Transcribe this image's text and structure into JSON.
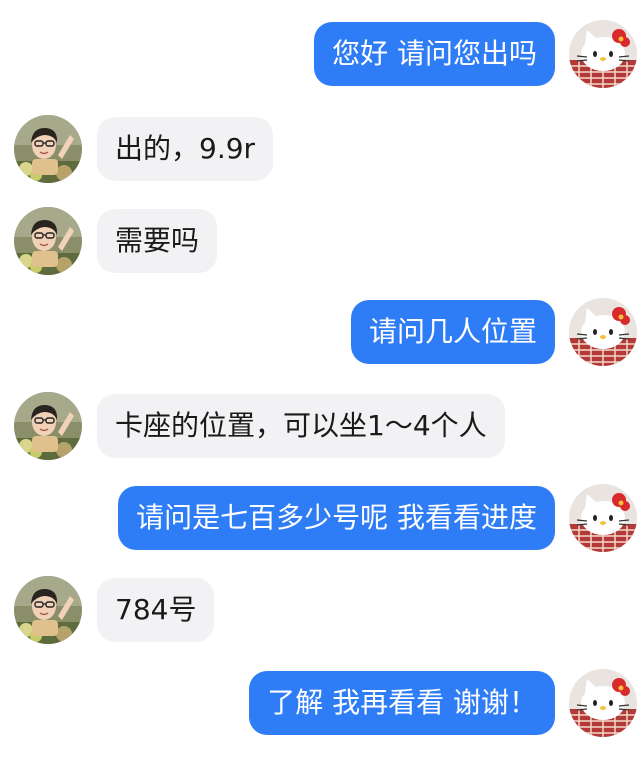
{
  "messages": [
    {
      "side": "right",
      "text": "您好 请问您出吗"
    },
    {
      "side": "left",
      "text": "出的，9.9r"
    },
    {
      "side": "left",
      "text": "需要吗"
    },
    {
      "side": "right",
      "text": "请问几人位置"
    },
    {
      "side": "left",
      "text": "卡座的位置，可以坐1～4个人"
    },
    {
      "side": "right",
      "text": "请问是七百多少号呢 我看看进度"
    },
    {
      "side": "left",
      "text": "784号"
    },
    {
      "side": "right",
      "text": "了解 我再看看 谢谢！"
    }
  ],
  "avatars": {
    "self": {
      "icon": "hello-kitty-avatar-icon"
    },
    "contact": {
      "icon": "person-photo-avatar-icon"
    }
  },
  "colors": {
    "outgoing_bubble": "#2f7df6",
    "incoming_bubble": "#f2f2f4",
    "outgoing_text": "#ffffff",
    "incoming_text": "#1a1a1a"
  }
}
